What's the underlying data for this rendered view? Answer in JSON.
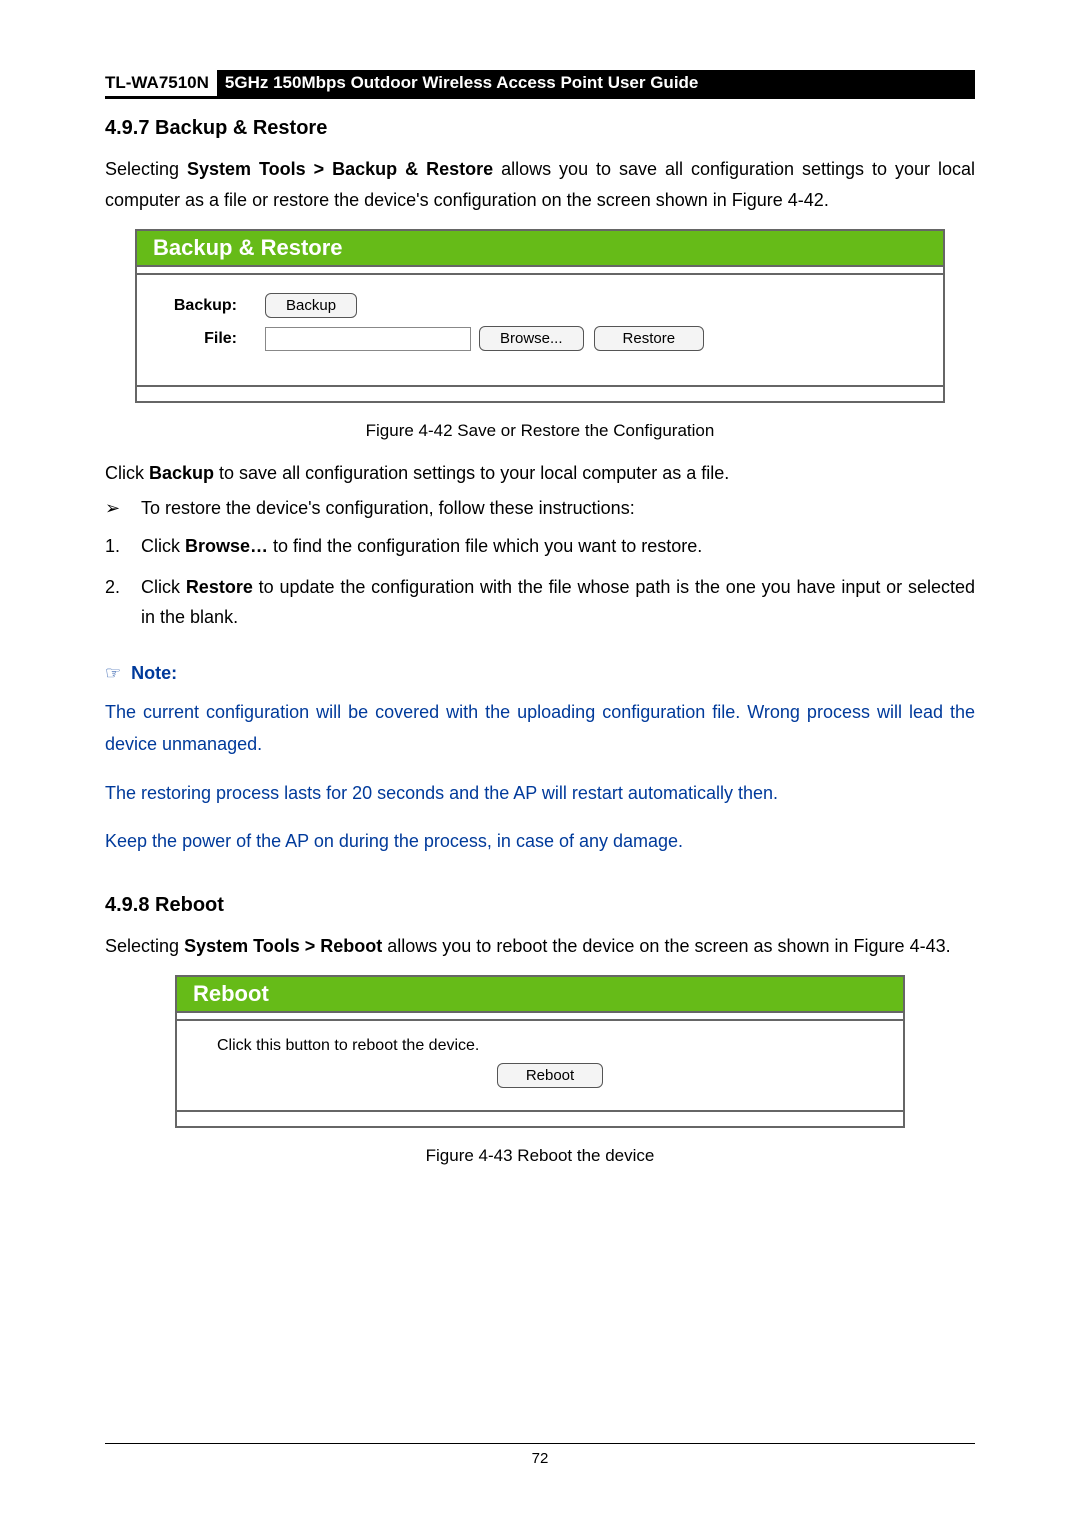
{
  "header": {
    "model": "TL-WA7510N",
    "title": "5GHz 150Mbps Outdoor Wireless Access Point User Guide"
  },
  "section_backup": {
    "heading": "4.9.7  Backup & Restore",
    "intro_pre": "Selecting ",
    "intro_bold": "System Tools > Backup & Restore",
    "intro_post": " allows you to save all configuration settings to your local computer as a file or restore the device's configuration on the screen shown in Figure 4-42.",
    "panel_title": "Backup & Restore",
    "label_backup": "Backup:",
    "label_file": "File:",
    "btn_backup": "Backup",
    "btn_browse": "Browse...",
    "btn_restore": "Restore",
    "file_value": "",
    "caption": "Figure 4-42 Save or Restore the Configuration",
    "click_pre": "Click ",
    "click_bold": "Backup",
    "click_post": " to save all configuration settings to your local computer as a file.",
    "bullet_arrow": "➢",
    "bullet_text": "To restore the device's configuration, follow these instructions:",
    "step1_num": "1.",
    "step1_pre": "Click ",
    "step1_bold": "Browse…",
    "step1_post": " to find the configuration file which you want to restore.",
    "step2_num": "2.",
    "step2_pre": "Click ",
    "step2_bold": "Restore",
    "step2_post": " to update the configuration with the file whose path is the one you have input     or selected in the blank."
  },
  "note": {
    "hand": "☞",
    "label": "Note:",
    "p1": "The current configuration will be covered with the uploading configuration file. Wrong process will lead the device unmanaged.",
    "p2": "The restoring process lasts for 20 seconds and the AP will restart automatically then.",
    "p3": "Keep the power of the AP on during the process, in case of any damage."
  },
  "section_reboot": {
    "heading": "4.9.8  Reboot",
    "intro_pre": "Selecting ",
    "intro_bold": "System Tools > Reboot",
    "intro_post": " allows you to reboot the device on the screen as shown in Figure 4-43.",
    "panel_title": "Reboot",
    "body_text": "Click this button to reboot the device.",
    "btn_reboot": "Reboot",
    "caption": "Figure 4-43 Reboot the device"
  },
  "page_number": "72"
}
